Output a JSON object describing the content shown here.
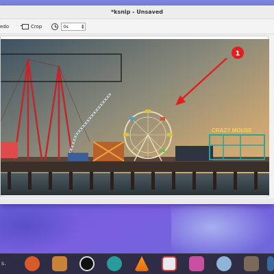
{
  "window": {
    "title": "*ksnip - Unsaved"
  },
  "toolbar": {
    "redo_label": "edo",
    "crop_label": "Crop",
    "delay_value": "0s",
    "delay_arrow_up": "▲",
    "delay_arrow_down": "▼"
  },
  "annotation": {
    "number_badge": "1",
    "badge_color": "#e02020",
    "arrow_color": "#e02020",
    "rect_color": "#222222"
  },
  "photo_signs": {
    "crazy_mouse": "CRAZY MOUSE"
  },
  "dock": {
    "left_label": "s.",
    "icons": [
      "app-icon-1",
      "app-icon-2",
      "obs-icon",
      "app-icon-4",
      "vlc-icon",
      "app-icon-6",
      "app-icon-7",
      "app-icon-8",
      "app-icon-9",
      "app-icon-10"
    ]
  }
}
